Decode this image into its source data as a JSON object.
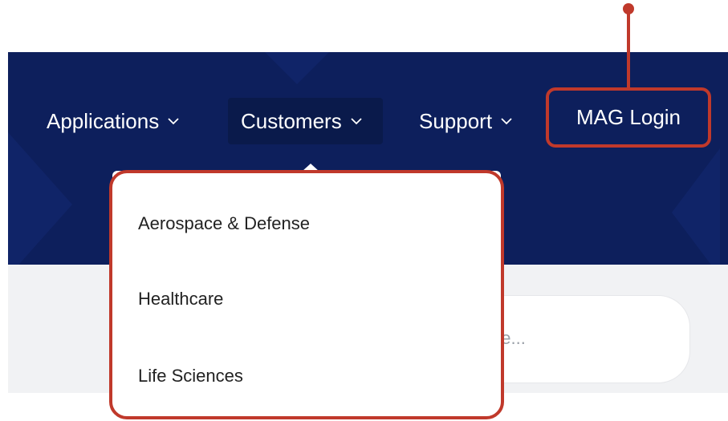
{
  "nav": {
    "items": [
      {
        "label": "Applications",
        "has_dropdown": true
      },
      {
        "label": "Customers",
        "has_dropdown": true,
        "active": true
      },
      {
        "label": "Support",
        "has_dropdown": true
      }
    ],
    "login_label": "MAG Login"
  },
  "dropdown": {
    "items": [
      {
        "label": "Aerospace & Defense"
      },
      {
        "label": "Healthcare"
      },
      {
        "label": "Life Sciences"
      }
    ]
  },
  "search": {
    "placeholder_visible": "ase..."
  },
  "colors": {
    "nav_background": "#0d1f5c",
    "active_nav_background": "#0a1a4b",
    "highlight": "#c0392b",
    "content_background": "#f1f2f4"
  },
  "icons": {
    "dropdown_chevron": "chevron-down-icon"
  }
}
